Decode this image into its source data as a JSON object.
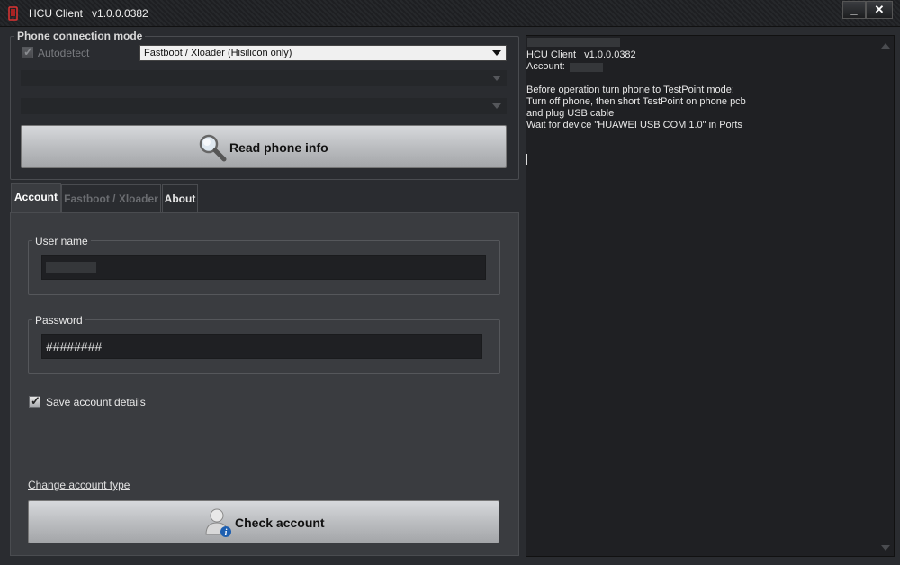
{
  "window": {
    "title": "HCU Client   v1.0.0.0382",
    "minimize_label": "_",
    "close_label": "✕"
  },
  "connection": {
    "legend": "Phone connection mode",
    "autodetect_label": "Autodetect",
    "autodetect_checked": true,
    "mode_selected": "Fastboot / Xloader (Hisilicon only)",
    "read_button": "Read phone info"
  },
  "tabs": [
    {
      "label": "Account",
      "state": "active"
    },
    {
      "label": "Fastboot / Xloader",
      "state": "disabled"
    },
    {
      "label": "About",
      "state": "normal"
    }
  ],
  "account": {
    "username_legend": "User name",
    "password_legend": "Password",
    "password_value": "########",
    "save_label": "Save account details",
    "save_checked": true,
    "change_type_link": "Change account type",
    "check_button": "Check account"
  },
  "log": {
    "lines": [
      "HCU Client   v1.0.0.0382",
      "Account:",
      "",
      "Before operation turn phone to TestPoint mode:",
      "Turn off phone, then short TestPoint on phone pcb",
      "and plug USB cable",
      "Wait for device \"HUAWEI USB COM 1.0\" in Ports"
    ]
  },
  "icons": {
    "app": "app-icon",
    "magnifier": "magnifier-icon",
    "user_info": "user-info-icon"
  }
}
